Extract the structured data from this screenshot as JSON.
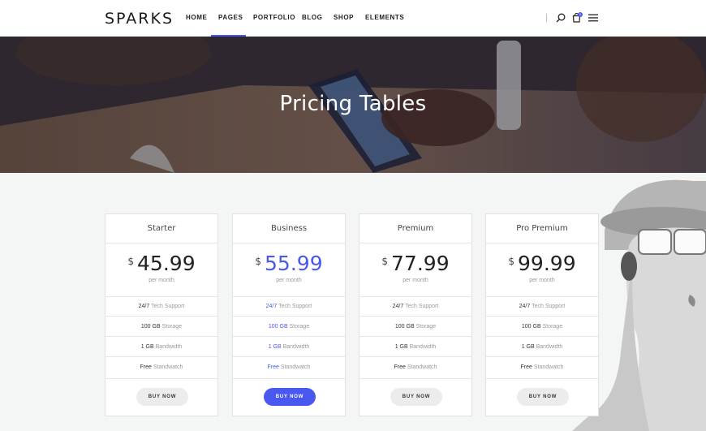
{
  "brand": {
    "logo_text": "SPARKS"
  },
  "nav": {
    "items": [
      {
        "label": "HOME"
      },
      {
        "label": "PAGES"
      },
      {
        "label": "PORTFOLIO"
      },
      {
        "label": "BLOG"
      },
      {
        "label": "SHOP"
      },
      {
        "label": "ELEMENTS"
      }
    ],
    "active_item": "PAGES",
    "cart_count": "0"
  },
  "icons": [
    "search-icon",
    "cart-icon",
    "menu-icon"
  ],
  "colors": {
    "accent": "#4a58f2",
    "page_bg": "#f4f5f5",
    "card_bg": "#ffffff"
  },
  "hero": {
    "title": "Pricing Tables"
  },
  "plans": [
    {
      "name": "Starter",
      "currency": "$",
      "price": "45.99",
      "period": "per month",
      "features": [
        {
          "value": "24/7",
          "label": "Tech Support"
        },
        {
          "value": "100 GB",
          "label": "Storage"
        },
        {
          "value": "1 GB",
          "label": "Bandwidth"
        },
        {
          "value": "Free",
          "label": "Standwatch"
        }
      ],
      "button": "BUY NOW"
    },
    {
      "name": "Business",
      "currency": "$",
      "price": "55.99",
      "period": "per month",
      "features": [
        {
          "value": "24/7",
          "label": "Tech Support"
        },
        {
          "value": "100 GB",
          "label": "Storage"
        },
        {
          "value": "1 GB",
          "label": "Bandwidth"
        },
        {
          "value": "Free",
          "label": "Standwatch"
        }
      ],
      "button": "BUY NOW",
      "highlighted": true
    },
    {
      "name": "Premium",
      "currency": "$",
      "price": "77.99",
      "period": "per month",
      "features": [
        {
          "value": "24/7",
          "label": "Tech Support"
        },
        {
          "value": "100 GB",
          "label": "Storage"
        },
        {
          "value": "1 GB",
          "label": "Bandwidth"
        },
        {
          "value": "Free",
          "label": "Standwatch"
        }
      ],
      "button": "BUY NOW"
    },
    {
      "name": "Pro Premium",
      "currency": "$",
      "price": "99.99",
      "period": "per month",
      "features": [
        {
          "value": "24/7",
          "label": "Tech Support"
        },
        {
          "value": "100 GB",
          "label": "Storage"
        },
        {
          "value": "1 GB",
          "label": "Bandwidth"
        },
        {
          "value": "Free",
          "label": "Standwatch"
        }
      ],
      "button": "BUY NOW"
    }
  ]
}
